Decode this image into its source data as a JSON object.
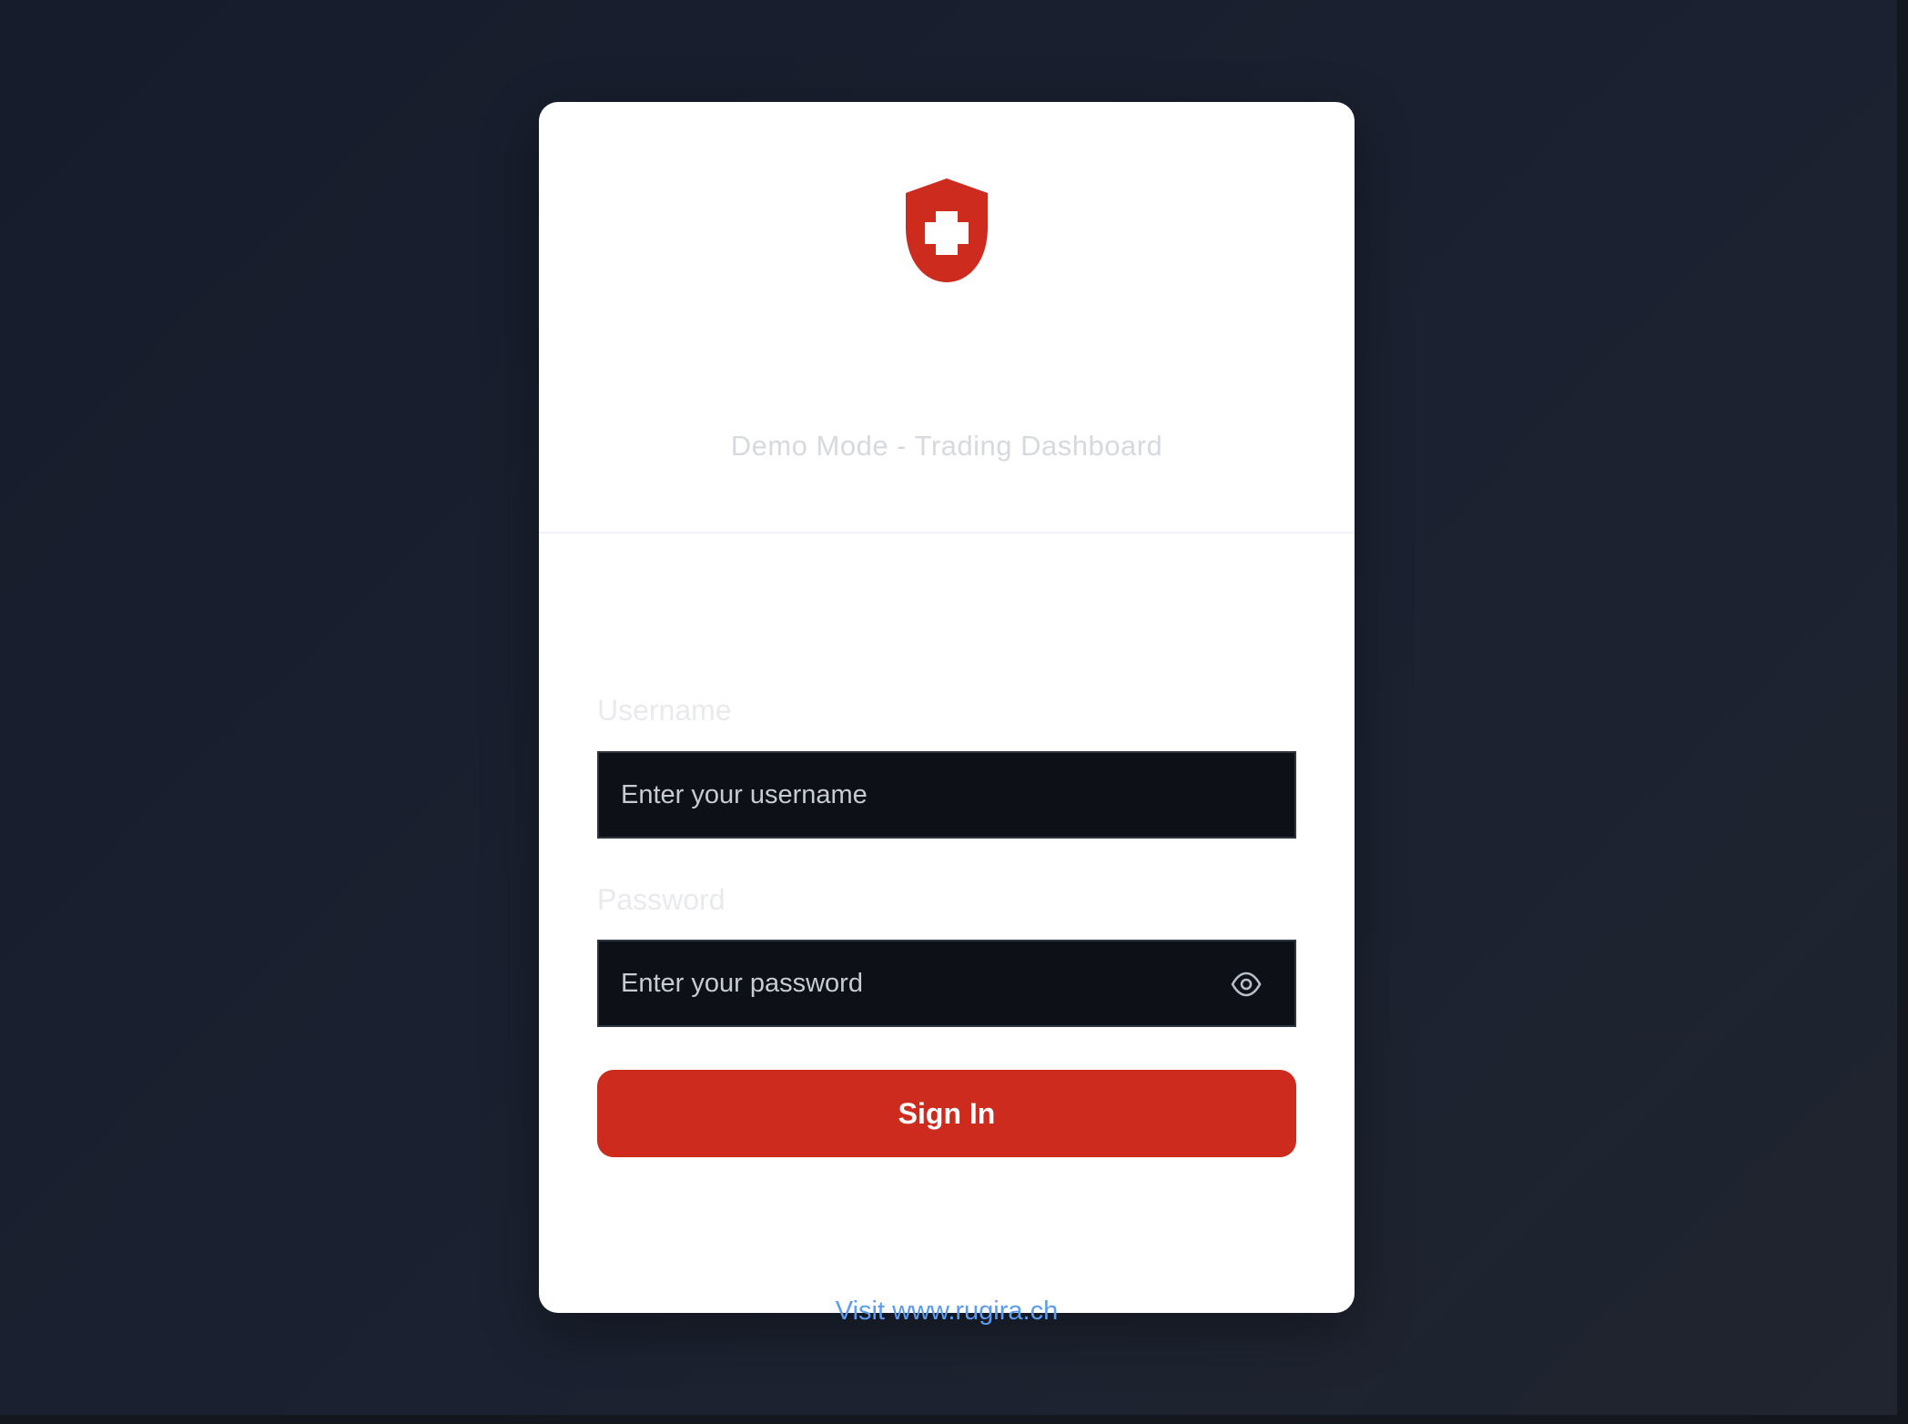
{
  "brand": {
    "logo_icon": "swiss-shield-icon",
    "accent_color": "#cd2b1e"
  },
  "header": {
    "subtitle": "Demo Mode - Trading Dashboard"
  },
  "form": {
    "username_label": "Username",
    "username_placeholder": "Enter your username",
    "password_label": "Password",
    "password_placeholder": "Enter your password",
    "password_toggle_icon": "eye-icon",
    "submit_label": "Sign In"
  },
  "footer": {
    "link_text": "Visit www.rugira.ch"
  }
}
